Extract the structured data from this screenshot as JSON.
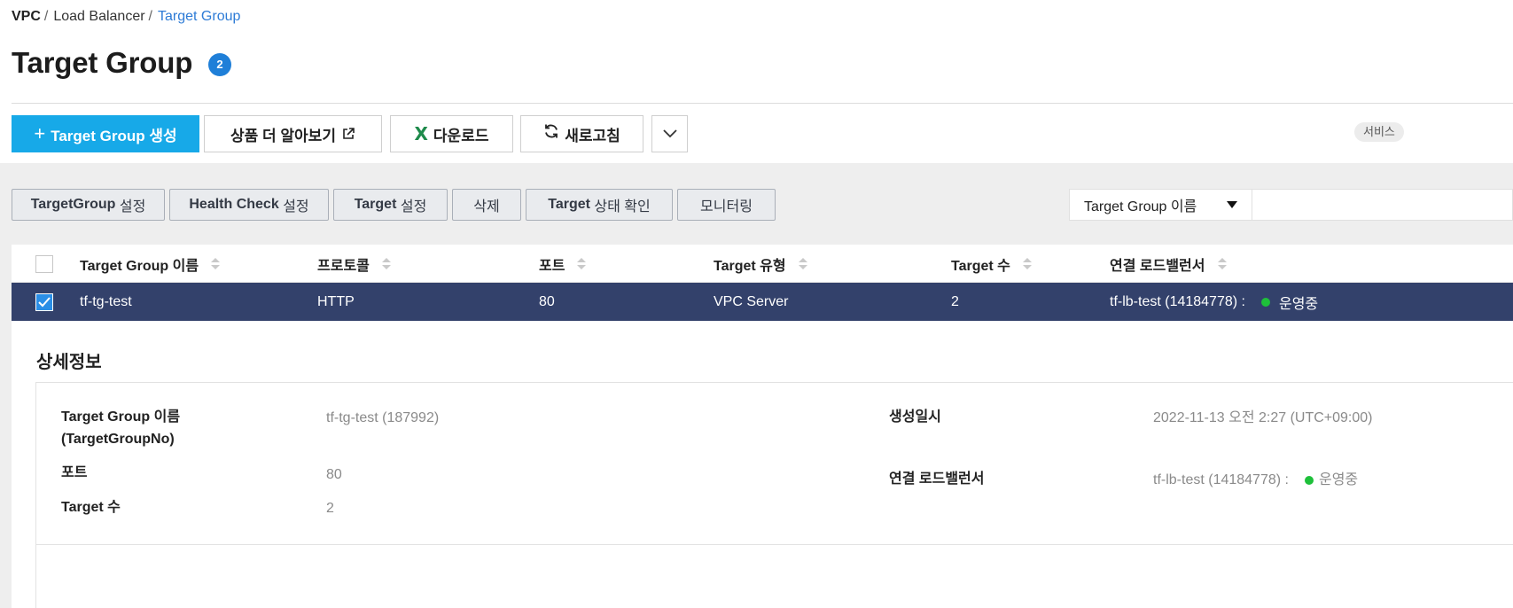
{
  "breadcrumb": {
    "items": [
      "VPC",
      "Load Balancer",
      "Target Group"
    ],
    "separator": "/"
  },
  "page": {
    "title": "Target Group",
    "count": "2"
  },
  "toolbar": {
    "create_label": "Target Group 생성",
    "learn_more_label": "상품 더 알아보기",
    "download_label": "다운로드",
    "refresh_label": "새로고침",
    "service_chip": "서비스"
  },
  "actions": {
    "tg_settings_en": "TargetGroup",
    "tg_settings_ko": "설정",
    "health_check_en": "Health Check",
    "health_check_ko": "설정",
    "target_settings_en": "Target",
    "target_settings_ko": "설정",
    "delete": "삭제",
    "target_status_en": "Target",
    "target_status_ko": "상태 확인",
    "monitoring": "모니터링"
  },
  "search": {
    "field_selected": "Target Group 이름",
    "query": ""
  },
  "table": {
    "columns": [
      "Target Group 이름",
      "프로토콜",
      "포트",
      "Target 유형",
      "Target 수",
      "연결 로드밸런서"
    ],
    "rows": [
      {
        "selected": true,
        "name": "tf-tg-test",
        "protocol": "HTTP",
        "port": "80",
        "target_type": "VPC Server",
        "target_count": "2",
        "load_balancer": "tf-lb-test (14184778) :",
        "lb_status": "운영중"
      }
    ]
  },
  "detail": {
    "title": "상세정보",
    "name_label_line1": "Target Group 이름",
    "name_label_line2": "(TargetGroupNo)",
    "name_value": "tf-tg-test (187992)",
    "port_label": "포트",
    "port_value": "80",
    "target_count_label": "Target 수",
    "target_count_value": "2",
    "created_label": "생성일시",
    "created_value": "2022-11-13 오전 2:27 (UTC+09:00)",
    "lb_label": "연결 로드밸런서",
    "lb_value": "tf-lb-test (14184778) :",
    "lb_status": "운영중"
  },
  "colors": {
    "primary": "#17a9e8",
    "link": "#2d7bd6",
    "badge": "#1f7fd8",
    "selected_row": "#33416b",
    "status_green": "#1ec03a",
    "excel_green": "#1e8a4b"
  }
}
